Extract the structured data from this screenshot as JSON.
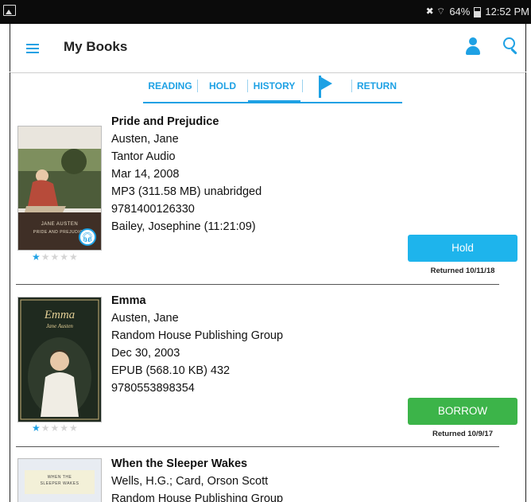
{
  "status_bar": {
    "signal_text": "✖ ⌔",
    "battery": "64%",
    "time": "12:52 PM"
  },
  "app_bar": {
    "title": "My Books"
  },
  "tabs": [
    {
      "label": "READING"
    },
    {
      "label": "HOLD"
    },
    {
      "label": "HISTORY",
      "active": true
    },
    {
      "label": "RETURN"
    }
  ],
  "colors": {
    "accent": "#1ea1e4",
    "hold_button": "#1eb4ec",
    "borrow_button": "#3cb449"
  },
  "books": [
    {
      "title": "Pride and Prejudice",
      "author": "Austen, Jane",
      "publisher": "Tantor Audio",
      "date": "Mar 14, 2008",
      "format": "MP3 (311.58 MB) unabridged",
      "isbn": "9781400126330",
      "narrator": "Bailey, Josephine (11:21:09)",
      "cover_title": "JANE AUSTEN",
      "cover_subtitle": "PRIDE AND PREJUDICE",
      "rating": 1,
      "action": "Hold",
      "returned": "Returned 10/11/18"
    },
    {
      "title": "Emma",
      "author": "Austen, Jane",
      "publisher": "Random House Publishing Group",
      "date": "Dec 30, 2003",
      "format": "EPUB (568.10 KB) 432",
      "isbn": "9780553898354",
      "cover_title": "Emma",
      "cover_subtitle": "Jane Austen",
      "rating": 1,
      "action": "BORROW",
      "returned": "Returned 10/9/17"
    },
    {
      "title": "When the Sleeper Wakes",
      "author": "Wells, H.G.; Card, Orson Scott",
      "publisher": "Random House Publishing Group",
      "cover_title": "WHEN THE",
      "cover_subtitle": "SLEEPER WAKES"
    }
  ]
}
